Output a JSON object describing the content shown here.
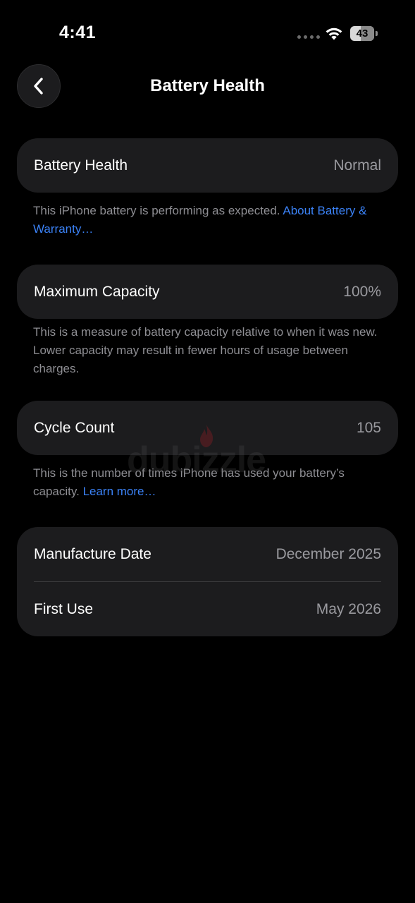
{
  "status_bar": {
    "time": "4:41",
    "battery_level": "43"
  },
  "nav": {
    "title": "Battery Health",
    "back_icon": "chevron-left-icon"
  },
  "battery_health": {
    "label": "Battery Health",
    "value": "Normal",
    "footnote": "This iPhone battery is performing as expected. ",
    "footnote_link": "About Battery & Warranty…"
  },
  "max_capacity": {
    "label": "Maximum Capacity",
    "value": "100%",
    "footnote": "This is a measure of battery capacity relative to when it was new. Lower capacity may result in fewer hours of usage between charges."
  },
  "cycle_count": {
    "label": "Cycle Count",
    "value": "105",
    "footnote": "This is the number of times iPhone has used your battery’s capacity. ",
    "footnote_link": "Learn more…"
  },
  "dates": {
    "manufacture_label": "Manufacture Date",
    "manufacture_value": "December 2025",
    "first_use_label": "First Use",
    "first_use_value": "May 2026"
  },
  "watermark": {
    "text": "dubizzle"
  },
  "colors": {
    "background": "#000000",
    "card": "#1c1c1e",
    "secondary_text": "#8e8e93",
    "link": "#3b82f6"
  }
}
